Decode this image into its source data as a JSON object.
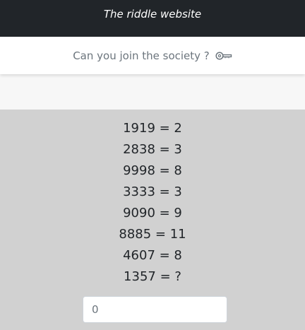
{
  "header": {
    "title": "The riddle website"
  },
  "subheader": {
    "tagline": "Can you join the society ?",
    "icon": "key-icon"
  },
  "riddle": {
    "lines": [
      "1919 = 2",
      "2838 = 3",
      "9998 = 8",
      "3333 = 3",
      "9090 = 9",
      "8885 = 11",
      "4607 = 8",
      "1357 = ?"
    ]
  },
  "answer": {
    "value": "0",
    "placeholder": "0"
  },
  "colors": {
    "topbar": "#212529",
    "subheader_bg": "#ffffff",
    "band_bg": "#f7f7f7",
    "content_bg": "#d1d1d1",
    "muted_text": "#6c757d"
  }
}
